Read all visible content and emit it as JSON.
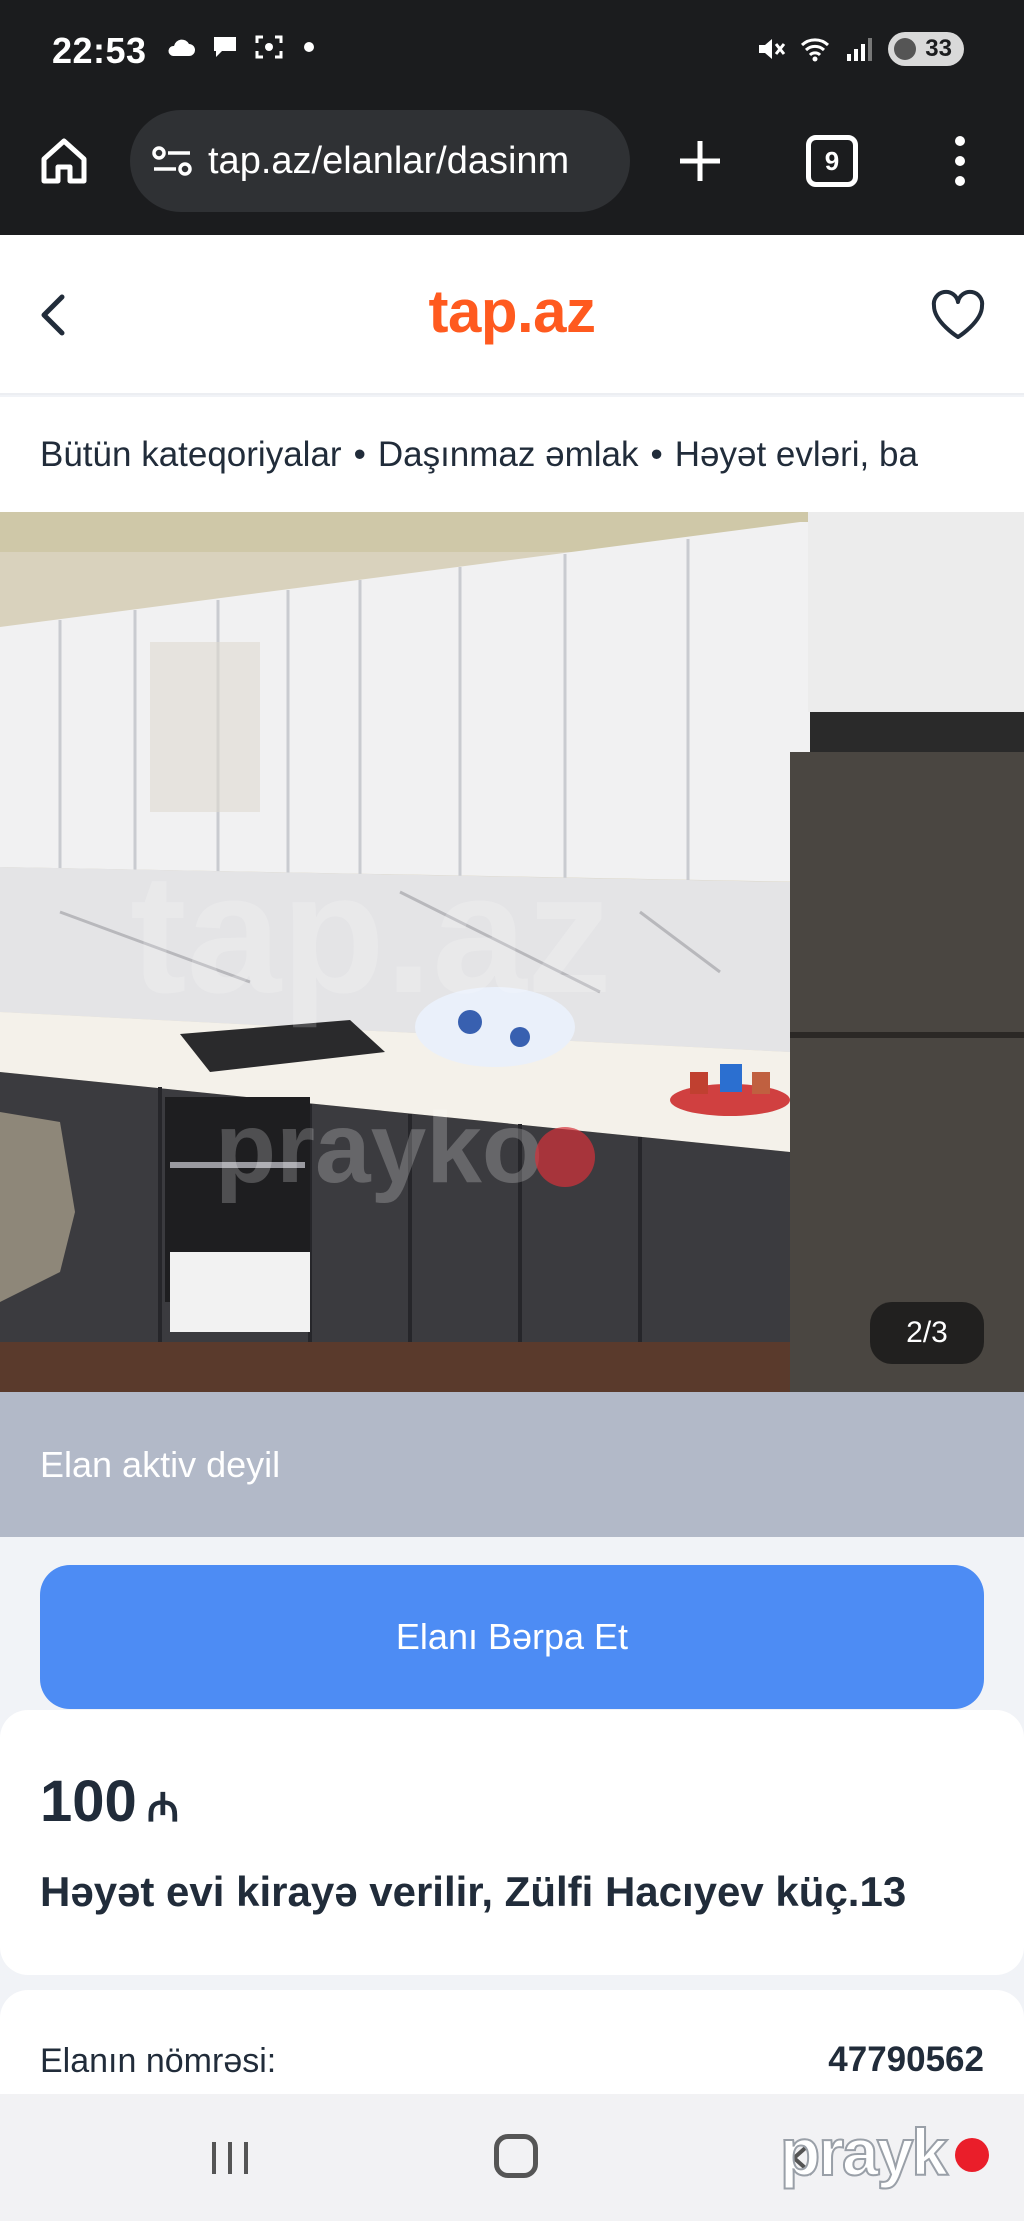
{
  "status_bar": {
    "time": "22:53",
    "battery": "33",
    "icons_left": [
      "cloud-icon",
      "chat-icon",
      "screenshot-icon",
      "dot-icon"
    ],
    "icons_right": [
      "mute-icon",
      "wifi-icon",
      "signal-icon",
      "battery-icon"
    ]
  },
  "browser": {
    "url": "tap.az/elanlar/dasinm",
    "tab_count": "9",
    "icons": [
      "home-icon",
      "site-settings-icon",
      "plus-icon",
      "tabs-icon",
      "more-vert-icon"
    ]
  },
  "header": {
    "logo": "tap.az",
    "icons": [
      "back-arrow-icon",
      "heart-icon"
    ]
  },
  "breadcrumb": {
    "items": [
      "Bütün kateqoriyalar",
      "Daşınmaz əmlak",
      "Həyət evləri, ba"
    ],
    "separator": "•"
  },
  "gallery": {
    "counter": "2/3",
    "watermark_logo": "tap.az",
    "watermark_brand": "prayko"
  },
  "listing": {
    "status": "Elan aktiv deyil",
    "restore_button": "Elanı Bərpa Et",
    "price": "100",
    "currency": "₼",
    "title": "Həyət evi kirayə verilir, Zülfi Hacıyev küç.13"
  },
  "details": {
    "number_label": "Elanın nömrəsi:",
    "number_value": "47790562"
  },
  "nav": {
    "icons": [
      "recents-icon",
      "home-nav-icon",
      "back-nav-icon"
    ]
  },
  "brand_watermark": "prayk",
  "colors": {
    "brand_orange": "#ff5a1f",
    "restore_blue": "#4d8cf4",
    "inactive_grey": "#b2b9c8",
    "dark_text": "#212c3a"
  }
}
